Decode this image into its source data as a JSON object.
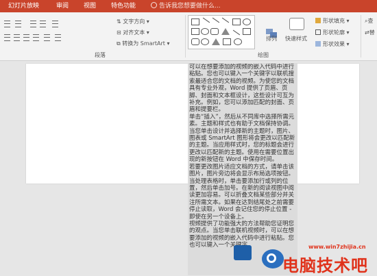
{
  "tabs": [
    {
      "label": "幻灯片放映"
    },
    {
      "label": "审阅"
    },
    {
      "label": "视图"
    },
    {
      "label": "特色功能"
    }
  ],
  "tell_me": "告诉我您想要做什么...",
  "ribbon": {
    "paragraph_group": "段落",
    "drawing_group": "绘图",
    "text_direction": "文字方向",
    "align_text": "对齐文本",
    "convert_smartart": "转换为 SmartArt",
    "arrange": "排列",
    "quick_styles": "快速样式",
    "shape_fill": "形状填充",
    "shape_outline": "形状轮廓",
    "shape_effects": "形状效果",
    "find_partial": "查",
    "replace_partial": "替"
  },
  "textbox": {
    "paragraphs": [
      "可以在想要添加的视频的嵌入代码中进行粘贴。您也可以键入一个关键字以联机搜索最适合您的文档的视频。为使您的文档具有专业外观，Word 提供了页眉、页脚、封面和文本框设计，这些设计可互为补充。例如，您可以添加匹配的封面、页眉和提要栏。",
      "单击“插入”，然后从不同库中选择所需元素。主题和样式也有助于文档保持协调。当您单击设计并选择新的主题时，图片、图表或 SmartArt 图形将会更改以匹配新的主题。当应用样式时，您的标题会进行更改以匹配新的主题。使用在需要位置出现的新按钮在 Word 中保存时间。",
      "若要更改图片适应文档的方式，请单击该图片，图片旁边将会显示布局选项按钮。当处理表格时，单击要添加行或列的位置，然后单击加号。在新的阅读视图中阅读更加容易。可以折叠文档某些部分并关注所需文本。如果在达到结尾处之前需要停止读取，Word 会记住您的停止位置 - 即使在另一个设备上。",
      "视频提供了功能强大的方法帮助您证明您的观点。当您单击联机视频时，可以在想要添加的视频的嵌入代码中进行粘贴。您也可以键入一个关键字"
    ]
  },
  "watermark": {
    "url": "www.win7zhijia.cn",
    "text": "电脑技术吧"
  }
}
